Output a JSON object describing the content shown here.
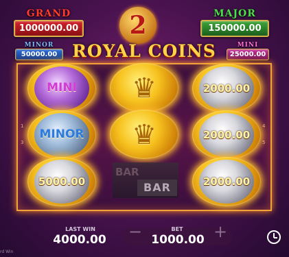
{
  "jackpots": {
    "grand": {
      "name": "GRAND",
      "value": "1000000.00"
    },
    "major": {
      "name": "MAJOR",
      "value": "150000.00"
    },
    "minor": {
      "name": "MINOR",
      "value": "50000.00"
    },
    "mini": {
      "name": "MINI",
      "value": "25000.00"
    }
  },
  "logo": {
    "number": "2",
    "text": "ROYAL COINS"
  },
  "reels": {
    "left": [
      {
        "label": "MINI",
        "kind": "mini-jackpot"
      },
      {
        "label": "MINOR",
        "kind": "minor-jackpot"
      },
      {
        "label": "5000.00",
        "kind": "silver-coin"
      }
    ],
    "middle": [
      {
        "kind": "crown-coin"
      },
      {
        "kind": "crown-coin"
      }
    ],
    "right": [
      {
        "label": "2000.00",
        "kind": "silver-coin"
      },
      {
        "label": "2000.00",
        "kind": "silver-coin"
      },
      {
        "label": "2000.00",
        "kind": "silver-coin"
      }
    ],
    "bar_symbols": [
      "BAR",
      "BAR"
    ]
  },
  "bottom": {
    "last_win_label": "LAST WIN",
    "last_win_value": "4000.00",
    "bet_label": "BET",
    "bet_value": "1000.00",
    "minus": "−",
    "plus": "+",
    "card_win_text": "rd Win"
  },
  "icons": [
    "clock-icon",
    "crown-icon"
  ],
  "colors": {
    "frame": "#f0a33a",
    "grand": "#d3222b",
    "major": "#3fa63a",
    "minor": "#2f6fd6",
    "mini": "#c9359c"
  }
}
